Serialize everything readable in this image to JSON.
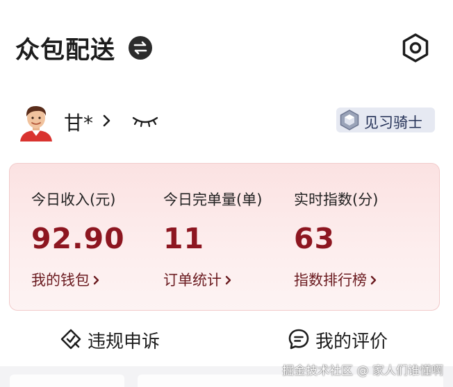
{
  "header": {
    "title": "众包配送",
    "switch_icon": "switch-arrows-icon",
    "settings_icon": "settings-hexagon-icon"
  },
  "user": {
    "name": "甘*",
    "chevron": "›",
    "eye_icon": "closed-eye-icon",
    "badge_label": "见习骑士",
    "badge_icon": "hexagon-gem-icon"
  },
  "stats": {
    "items": [
      {
        "label": "今日收入(元)",
        "value": "92.90",
        "link": "我的钱包"
      },
      {
        "label": "今日完单量(单)",
        "value": "11",
        "link": "订单统计"
      },
      {
        "label": "实时指数(分)",
        "value": "63",
        "link": "指数排行榜"
      }
    ]
  },
  "actions": {
    "appeal_label": "违规申诉",
    "review_label": "我的评价"
  },
  "watermark": "掘金技术社区 @ 家人们谁懂啊",
  "colors": {
    "accent_value": "#8d1620",
    "card_bg": "#fbe2e2",
    "card_border": "#f1caca",
    "badge_bg": "#e6e9f2",
    "badge_text": "#243157"
  }
}
